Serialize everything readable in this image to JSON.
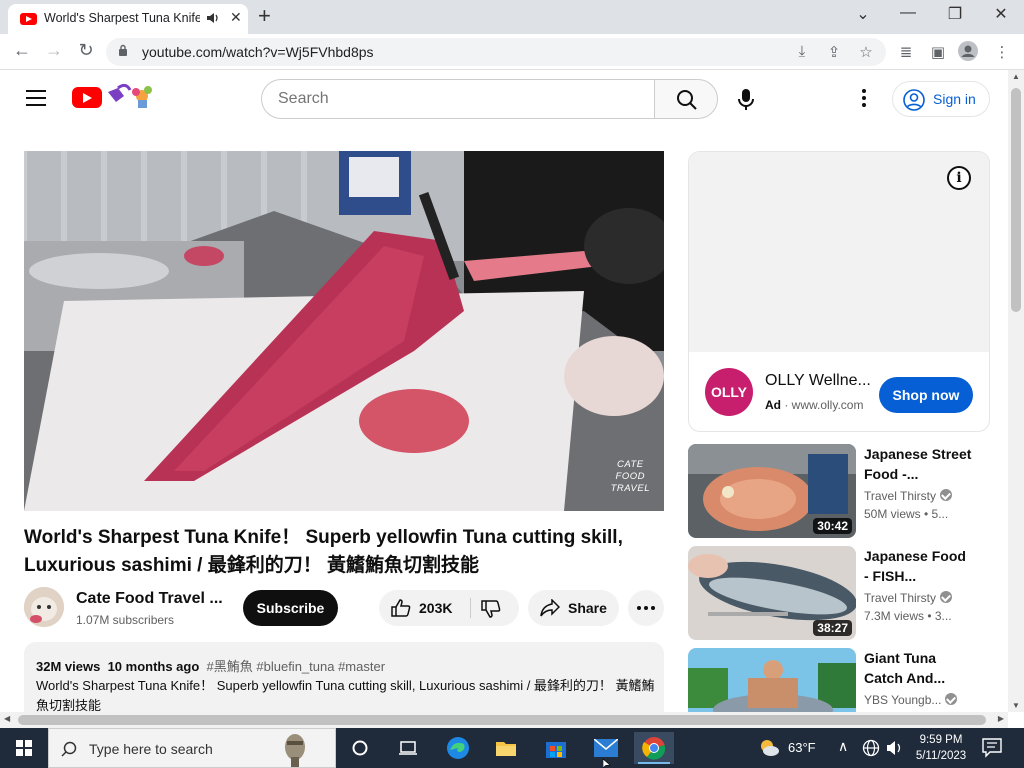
{
  "browser": {
    "tab_title": "World's Sharpest Tuna Knife",
    "url": "youtube.com/watch?v=Wj5FVhbd8ps"
  },
  "header": {
    "search_placeholder": "Search",
    "sign_in_label": "Sign in"
  },
  "video": {
    "watermark_line1": "CATE",
    "watermark_line2": "FOOD",
    "watermark_line3": "TRAVEL",
    "title": "World's Sharpest Tuna Knife！ Superb yellowfin Tuna cutting skill, Luxurious sashimi / 最鋒利的刀！ 黃鰭鮪魚切割技能",
    "channel_name": "Cate Food Travel ...",
    "subscribers": "1.07M subscribers",
    "subscribe_label": "Subscribe",
    "like_count": "203K",
    "share_label": "Share"
  },
  "description": {
    "views": "32M views",
    "age": "10 months ago",
    "hashtags": "#黑鮪魚 #bluefin_tuna #master",
    "text": "World's Sharpest Tuna Knife！ Superb yellowfin Tuna cutting skill, Luxurious sashimi / 最鋒利的刀！ 黃鰭鮪魚切割技能"
  },
  "ad": {
    "logo_text": "OLLY",
    "title": "OLLY Wellne...",
    "badge": "Ad",
    "domain": "www.olly.com",
    "cta": "Shop now"
  },
  "related": [
    {
      "title": "Japanese Street Food -...",
      "channel": "Travel Thirsty",
      "views": "50M views • 5...",
      "duration": "30:42"
    },
    {
      "title": "Japanese Food - FISH...",
      "channel": "Travel Thirsty",
      "views": "7.3M views • 3...",
      "duration": "38:27"
    },
    {
      "title": "Giant Tuna Catch And...",
      "channel": "YBS Youngb...",
      "views": "",
      "duration": ""
    }
  ],
  "taskbar": {
    "search_placeholder": "Type here to search",
    "temperature": "63°F",
    "time": "9:59 PM",
    "date": "5/11/2023"
  }
}
